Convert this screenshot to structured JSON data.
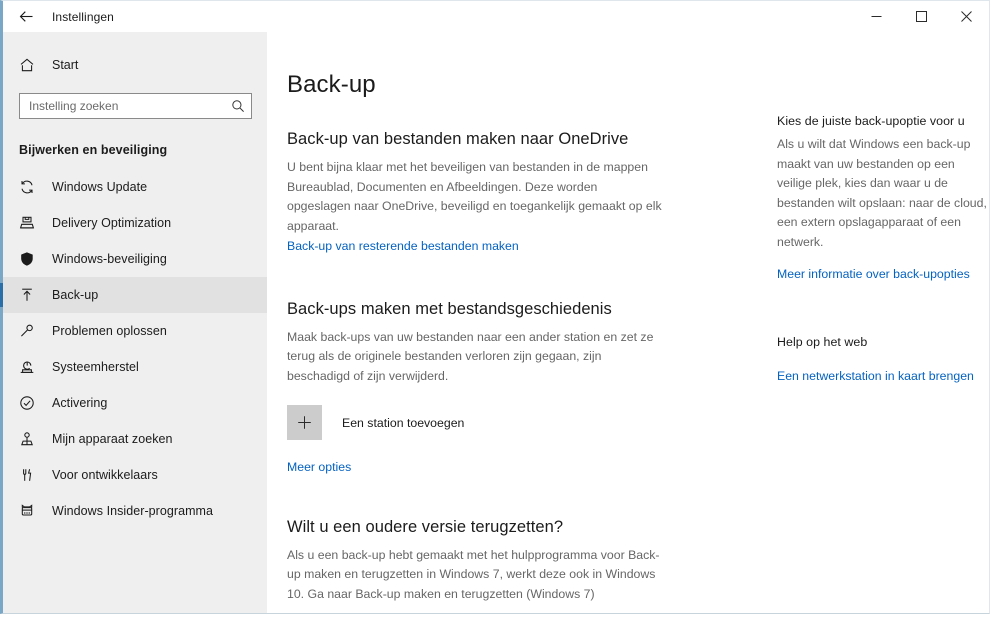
{
  "titlebar": {
    "back_label": "back-arrow",
    "title": "Instellingen",
    "minimize": "—",
    "maximize": "☐",
    "close": "✕"
  },
  "sidebar": {
    "home": {
      "label": "Start",
      "icon": "home-icon"
    },
    "search": {
      "value": "",
      "placeholder": "Instelling zoeken",
      "icon": "search-icon"
    },
    "group_title": "Bijwerken en beveiliging",
    "items": [
      {
        "label": "Windows Update",
        "icon": "sync-icon",
        "selected": false
      },
      {
        "label": "Delivery Optimization",
        "icon": "delivery-box-icon",
        "selected": false
      },
      {
        "label": "Windows-beveiliging",
        "icon": "shield-icon",
        "selected": false
      },
      {
        "label": "Back-up",
        "icon": "upload-arrow-icon",
        "selected": true
      },
      {
        "label": "Problemen oplossen",
        "icon": "wrench-icon",
        "selected": false
      },
      {
        "label": "Systeemherstel",
        "icon": "system-restore-icon",
        "selected": false
      },
      {
        "label": "Activering",
        "icon": "check-circle-icon",
        "selected": false
      },
      {
        "label": "Mijn apparaat zoeken",
        "icon": "locate-device-icon",
        "selected": false
      },
      {
        "label": "Voor ontwikkelaars",
        "icon": "developer-tools-icon",
        "selected": false
      },
      {
        "label": "Windows Insider-programma",
        "icon": "insider-ninjacat-icon",
        "selected": false
      }
    ]
  },
  "main": {
    "page_title": "Back-up",
    "section_onedrive": {
      "heading": "Back-up van bestanden maken naar OneDrive",
      "body": "U bent bijna klaar met het beveiligen van bestanden in de mappen Bureaublad, Documenten en Afbeeldingen. Deze worden opgeslagen naar OneDrive, beveiligd en toegankelijk gemaakt op elk apparaat.",
      "link": "Back-up van resterende bestanden maken"
    },
    "section_filehistory": {
      "heading": "Back-ups maken met bestandsgeschiedenis",
      "body": "Maak back-ups van uw bestanden naar een ander station en zet ze terug als de originele bestanden verloren zijn gegaan, zijn beschadigd of zijn verwijderd.",
      "add_drive_label": "Een station toevoegen",
      "add_drive_icon": "plus-icon",
      "more_options_link": "Meer opties"
    },
    "section_restore": {
      "heading": "Wilt u een oudere versie terugzetten?",
      "body": "Als u een back-up hebt gemaakt met het hulpprogramma voor Back-up maken en terugzetten in Windows 7, werkt deze ook in Windows 10. Ga naar Back-up maken en terugzetten (Windows 7)"
    }
  },
  "help": {
    "heading": "Kies de juiste back-upoptie voor u",
    "body": "Als u wilt dat Windows een back-up maakt van uw bestanden op een veilige plek, kies dan waar u de bestanden wilt opslaan: naar de cloud, een extern opslagapparaat of een netwerk.",
    "link": "Meer informatie over back-upopties",
    "web_help_heading": "Help op het web",
    "web_help_link": "Een netwerkstation in kaart brengen"
  },
  "colors": {
    "accent_bar": "#2a6fa8",
    "link": "#0462c1",
    "sidebar_bg": "#efefef",
    "body_text": "#666666",
    "heading_text": "#1b1b1b",
    "window_border": "#7ba7c7"
  }
}
